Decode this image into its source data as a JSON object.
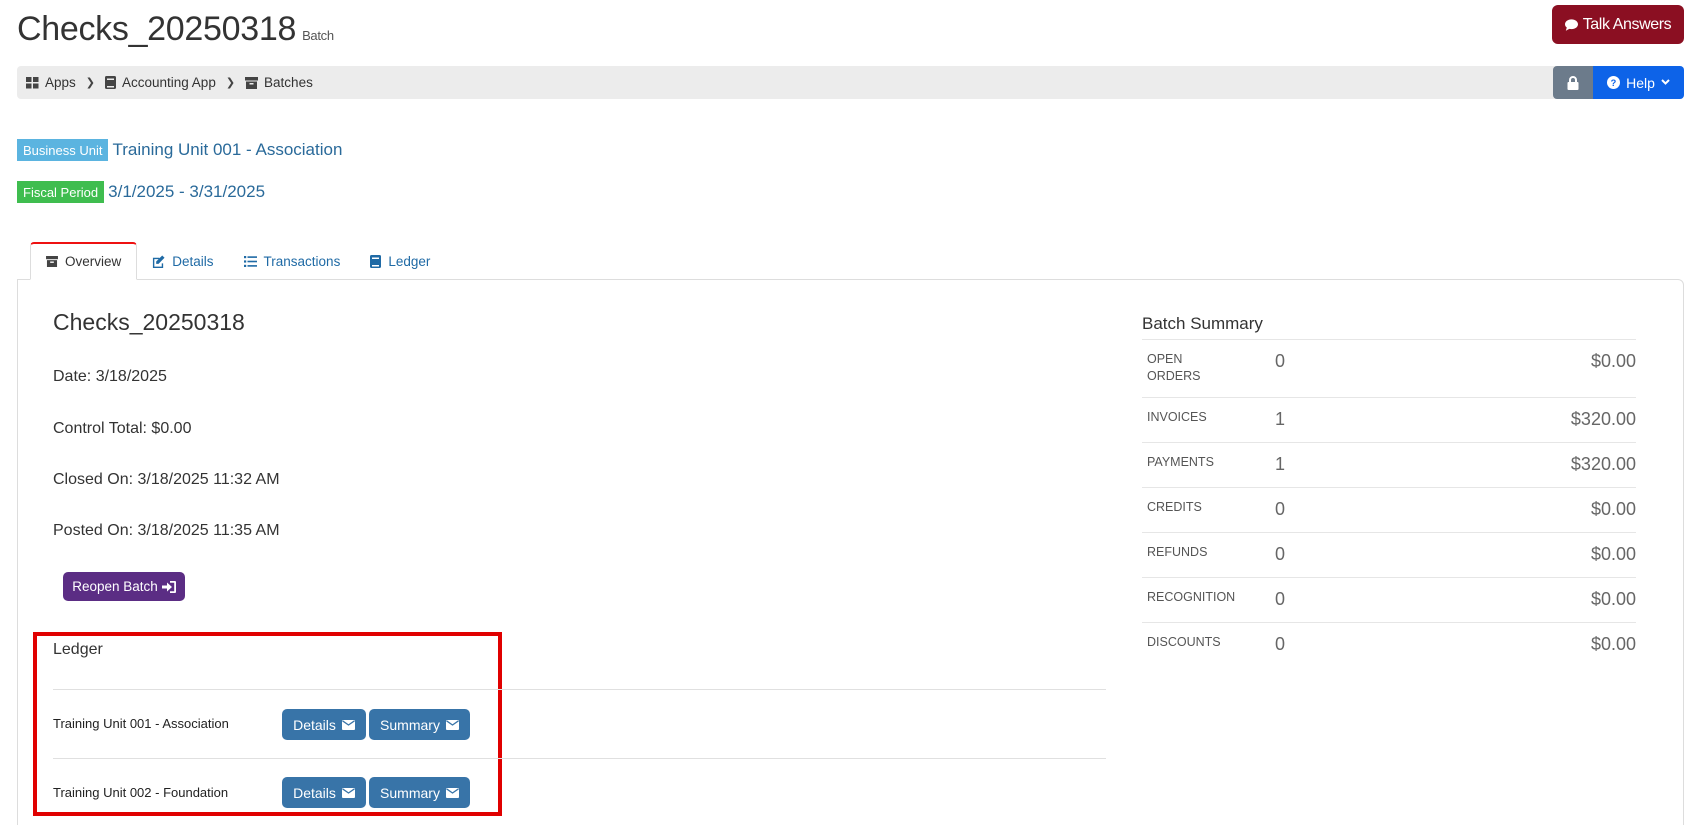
{
  "header": {
    "title": "Checks_20250318",
    "subtitle": "Batch",
    "talk_answers": "Talk Answers"
  },
  "breadcrumb": [
    {
      "label": "Apps",
      "icon": "grid-icon"
    },
    {
      "label": "Accounting App",
      "icon": "book-icon"
    },
    {
      "label": "Batches",
      "icon": "archive-icon"
    }
  ],
  "help_label": "Help",
  "business_unit": {
    "tag": "Business Unit",
    "value": "Training Unit 001 - Association"
  },
  "fiscal_period": {
    "tag": "Fiscal Period",
    "value": "3/1/2025 - 3/31/2025"
  },
  "tabs": [
    {
      "label": "Overview",
      "icon": "archive-icon"
    },
    {
      "label": "Details",
      "icon": "edit-icon"
    },
    {
      "label": "Transactions",
      "icon": "list-icon"
    },
    {
      "label": "Ledger",
      "icon": "book-icon"
    }
  ],
  "overview": {
    "name": "Checks_20250318",
    "date": "Date: 3/18/2025",
    "control_total": "Control Total: $0.00",
    "closed_on": "Closed On: 3/18/2025 11:32 AM",
    "posted_on": "Posted On: 3/18/2025 11:35 AM",
    "reopen_label": "Reopen Batch"
  },
  "ledger": {
    "title": "Ledger",
    "rows": [
      {
        "unit": "Training Unit 001 - Association",
        "details": "Details",
        "summary": "Summary"
      },
      {
        "unit": "Training Unit 002 - Foundation",
        "details": "Details",
        "summary": "Summary"
      }
    ]
  },
  "batch_summary": {
    "title": "Batch Summary",
    "rows": [
      {
        "name": "OPEN ORDERS",
        "count": "0",
        "amount": "$0.00"
      },
      {
        "name": "INVOICES",
        "count": "1",
        "amount": "$320.00"
      },
      {
        "name": "PAYMENTS",
        "count": "1",
        "amount": "$320.00"
      },
      {
        "name": "CREDITS",
        "count": "0",
        "amount": "$0.00"
      },
      {
        "name": "REFUNDS",
        "count": "0",
        "amount": "$0.00"
      },
      {
        "name": "RECOGNITION",
        "count": "0",
        "amount": "$0.00"
      },
      {
        "name": "DISCOUNTS",
        "count": "0",
        "amount": "$0.00"
      }
    ]
  }
}
